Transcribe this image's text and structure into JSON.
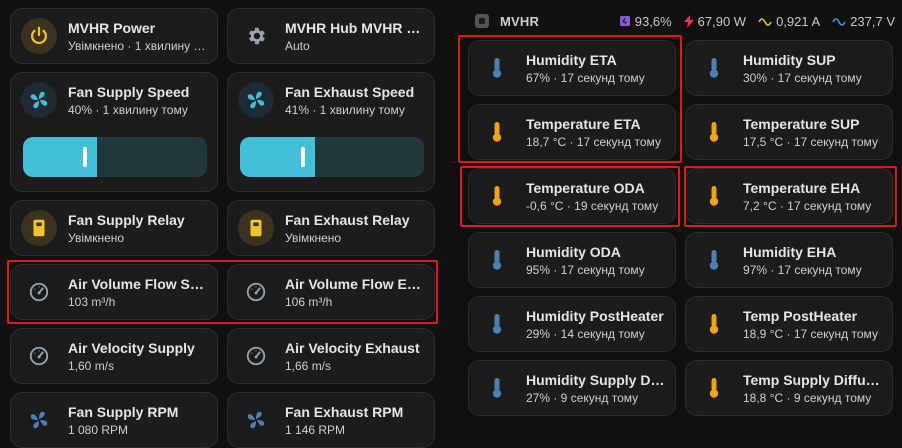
{
  "left": {
    "mvhr_power": {
      "title": "MVHR Power",
      "state": "Увімкнено · 1 хвилину тому"
    },
    "mvhr_hub": {
      "title": "MVHR Hub MVHR Mode",
      "state": "Auto"
    },
    "fan_supply_speed": {
      "title": "Fan Supply Speed",
      "state": "40% · 1 хвилину тому",
      "level": 0.4
    },
    "fan_exhaust_speed": {
      "title": "Fan Exhaust Speed",
      "state": "41% · 1 хвилину тому",
      "level": 0.41
    },
    "fan_supply_relay": {
      "title": "Fan Supply Relay",
      "state": "Увімкнено"
    },
    "fan_exhaust_relay": {
      "title": "Fan Exhaust Relay",
      "state": "Увімкнено"
    },
    "air_flow_supply": {
      "title": "Air Volume Flow Supply",
      "state": "103 m³/h"
    },
    "air_flow_exhaust": {
      "title": "Air Volume Flow Exhaust",
      "state": "106 m³/h"
    },
    "air_velocity_supply": {
      "title": "Air Velocity Supply",
      "state": "1,60 m/s"
    },
    "air_velocity_exhaust": {
      "title": "Air Velocity Exhaust",
      "state": "1,66 m/s"
    },
    "fan_supply_rpm": {
      "title": "Fan Supply RPM",
      "state": "1 080 RPM"
    },
    "fan_exhaust_rpm": {
      "title": "Fan Exhaust RPM",
      "state": "1 146 RPM"
    }
  },
  "header": {
    "title": "MVHR",
    "battery": "93,6%",
    "power": "67,90 W",
    "current": "0,921 A",
    "voltage": "237,7 V"
  },
  "right": {
    "humidity_eta": {
      "title": "Humidity ETA",
      "state": "67% · 17 секунд тому"
    },
    "humidity_sup": {
      "title": "Humidity SUP",
      "state": "30% · 17 секунд тому"
    },
    "temperature_eta": {
      "title": "Temperature ETA",
      "state": "18,7 °C · 17 секунд тому"
    },
    "temperature_sup": {
      "title": "Temperature SUP",
      "state": "17,5 °C · 17 секунд тому"
    },
    "temperature_oda": {
      "title": "Temperature ODA",
      "state": "-0,6 °C · 19 секунд тому"
    },
    "temperature_eha": {
      "title": "Temperature EHA",
      "state": "7,2 °C · 17 секунд тому"
    },
    "humidity_oda": {
      "title": "Humidity ODA",
      "state": "95% · 17 секунд тому"
    },
    "humidity_eha": {
      "title": "Humidity EHA",
      "state": "97% · 17 секунд тому"
    },
    "humidity_postheater": {
      "title": "Humidity PostHeater",
      "state": "29% · 14 секунд тому"
    },
    "temp_postheater": {
      "title": "Temp PostHeater",
      "state": "18,9 °C · 17 секунд тому"
    },
    "humidity_supply_diffuser": {
      "title": "Humidity Supply Diffuser",
      "state": "27% · 9 секунд тому"
    },
    "temp_supply_diffuser": {
      "title": "Temp Supply Diffuser",
      "state": "18,8 °C · 9 секунд тому"
    }
  },
  "colors": {
    "accent_yellow": "#f5c32c",
    "accent_cyan": "#43c0d8",
    "humidity_blue": "#4f7fb5",
    "temperature_orange": "#f0a21a",
    "icon_gray": "#9aa4ae",
    "highlight_red": "#e01919"
  }
}
